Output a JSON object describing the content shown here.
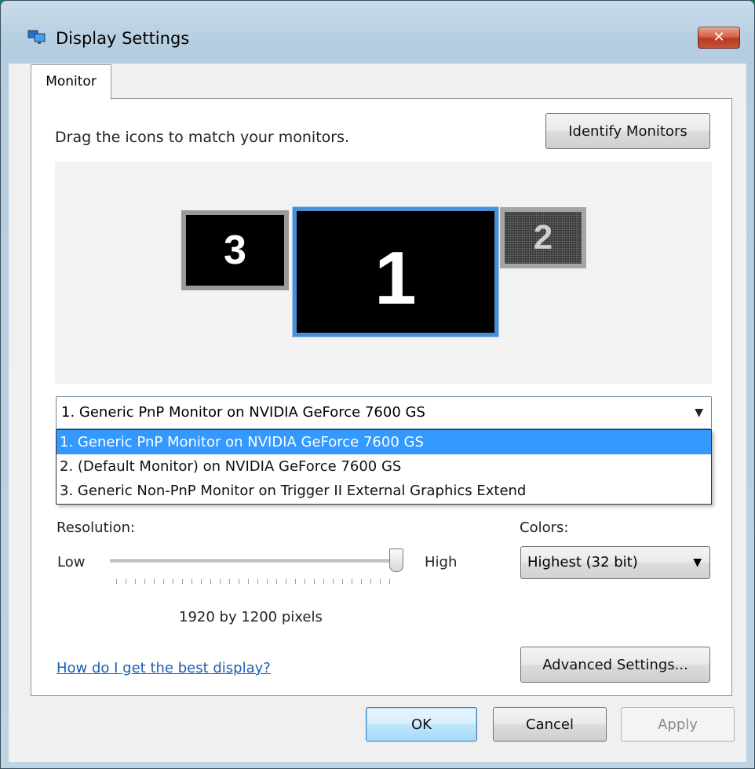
{
  "window": {
    "title": "Display Settings",
    "close_symbol": "✕"
  },
  "tabs": [
    {
      "label": "Monitor"
    }
  ],
  "monitor_tab": {
    "instructions": "Drag the icons to match your monitors.",
    "identify_button": "Identify Monitors",
    "monitors": [
      {
        "number": "3",
        "state": "inactive"
      },
      {
        "number": "1",
        "state": "selected"
      },
      {
        "number": "2",
        "state": "disabled"
      }
    ],
    "monitor_select": {
      "value": "1. Generic PnP Monitor on NVIDIA GeForce 7600 GS",
      "options": [
        "1. Generic PnP Monitor on NVIDIA GeForce 7600 GS",
        "2. (Default Monitor) on NVIDIA GeForce 7600 GS",
        "3. Generic Non-PnP Monitor on Trigger II External Graphics Extend"
      ],
      "highlighted_index": 0
    },
    "resolution": {
      "label": "Resolution:",
      "low": "Low",
      "high": "High",
      "value": "1920 by 1200 pixels",
      "slider_position": "max"
    },
    "colors": {
      "label": "Colors:",
      "value": "Highest (32 bit)"
    },
    "help_link": "How do I get the best display?",
    "advanced_button": "Advanced Settings..."
  },
  "footer": {
    "ok": "OK",
    "cancel": "Cancel",
    "apply": "Apply"
  },
  "colors": {
    "selection": "#3399ff",
    "link": "#1a5fb4",
    "monitor_selected_border": "#4a8fd6",
    "close_button": "#c9503a"
  },
  "icons": {
    "app": "display-settings-icon",
    "dropdown": "chevron-down-icon"
  }
}
